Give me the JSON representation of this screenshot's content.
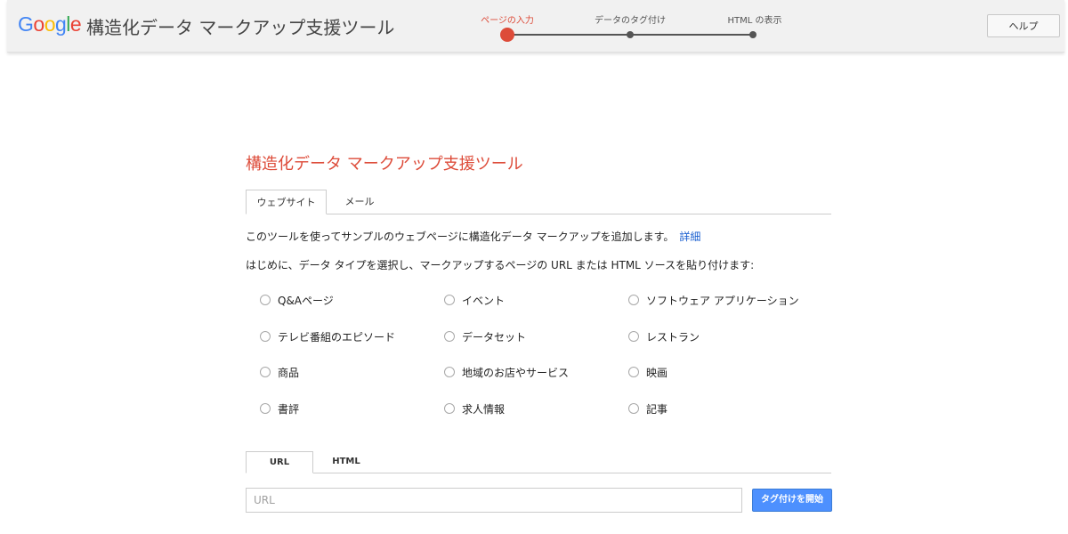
{
  "header": {
    "logo": {
      "letters": [
        {
          "char": "G",
          "color": "#4285f4"
        },
        {
          "char": "o",
          "color": "#ea4335"
        },
        {
          "char": "o",
          "color": "#fbbc05"
        },
        {
          "char": "g",
          "color": "#4285f4"
        },
        {
          "char": "l",
          "color": "#34a853"
        },
        {
          "char": "e",
          "color": "#ea4335"
        }
      ]
    },
    "app_title": "構造化データ マークアップ支援ツール",
    "steps": [
      {
        "label": "ページの入力",
        "active": true
      },
      {
        "label": "データのタグ付け",
        "active": false
      },
      {
        "label": "HTML の表示",
        "active": false
      }
    ],
    "help_label": "ヘルプ"
  },
  "main": {
    "title": "構造化データ マークアップ支援ツール",
    "tabs": [
      {
        "label": "ウェブサイト",
        "active": true
      },
      {
        "label": "メール",
        "active": false
      }
    ],
    "intro_text": "このツールを使ってサンプルのウェブページに構造化データ マークアップを追加します。",
    "details_link": "詳細",
    "instruction": "はじめに、データ タイプを選択し、マークアップするページの URL または HTML ソースを貼り付けます:",
    "data_types": [
      "Q&Aページ",
      "イベント",
      "ソフトウェア アプリケーション",
      "テレビ番組のエピソード",
      "データセット",
      "レストラン",
      "商品",
      "地域のお店やサービス",
      "映画",
      "書評",
      "求人情報",
      "記事"
    ],
    "source_tabs": [
      {
        "label": "URL",
        "active": true
      },
      {
        "label": "HTML",
        "active": false
      }
    ],
    "url_placeholder": "URL",
    "start_button": "タグ付けを開始"
  },
  "colors": {
    "accent": "#dd4b39",
    "link": "#1a5fd0",
    "button": "#4d90fe"
  }
}
